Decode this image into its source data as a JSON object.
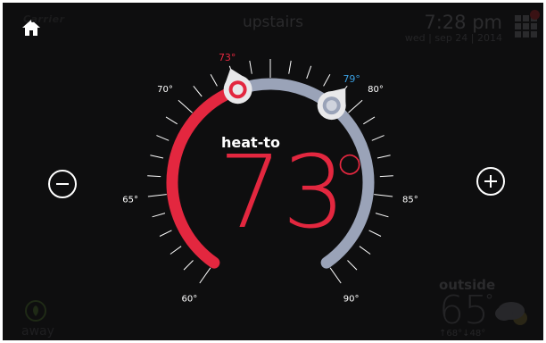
{
  "header": {
    "logo_text": "Carrier",
    "location": "upstairs",
    "time": "7:28 pm",
    "date": "wed | sep 24 | 2014"
  },
  "icons": {
    "home": "home-icon",
    "menu": "grid-menu-icon",
    "minus": "minus-icon",
    "plus": "plus-icon",
    "weather": "partly-cloudy-icon",
    "away": "leaf-icon"
  },
  "dial": {
    "mode_label": "heat-to",
    "setpoint": "73",
    "heat_marker_label": "73°",
    "cool_marker_label": "79°",
    "scale_labels": {
      "t60": "60°",
      "t65": "65°",
      "t70": "70°",
      "t80": "80°",
      "t85": "85°",
      "t90": "90°"
    },
    "heat_setpoint": 73,
    "cool_setpoint": 79,
    "scale_min": 60,
    "scale_max": 90
  },
  "outside": {
    "label": "outside",
    "temp": "65",
    "hilo": "↑68°↓48°"
  },
  "away": {
    "label": "away"
  },
  "colors": {
    "heat": "#e3273f",
    "cool": "#9aa3b8",
    "background": "#0e0e0f",
    "heat_marker_label": "#e3273f",
    "cool_marker_label": "#3a9ee0"
  }
}
